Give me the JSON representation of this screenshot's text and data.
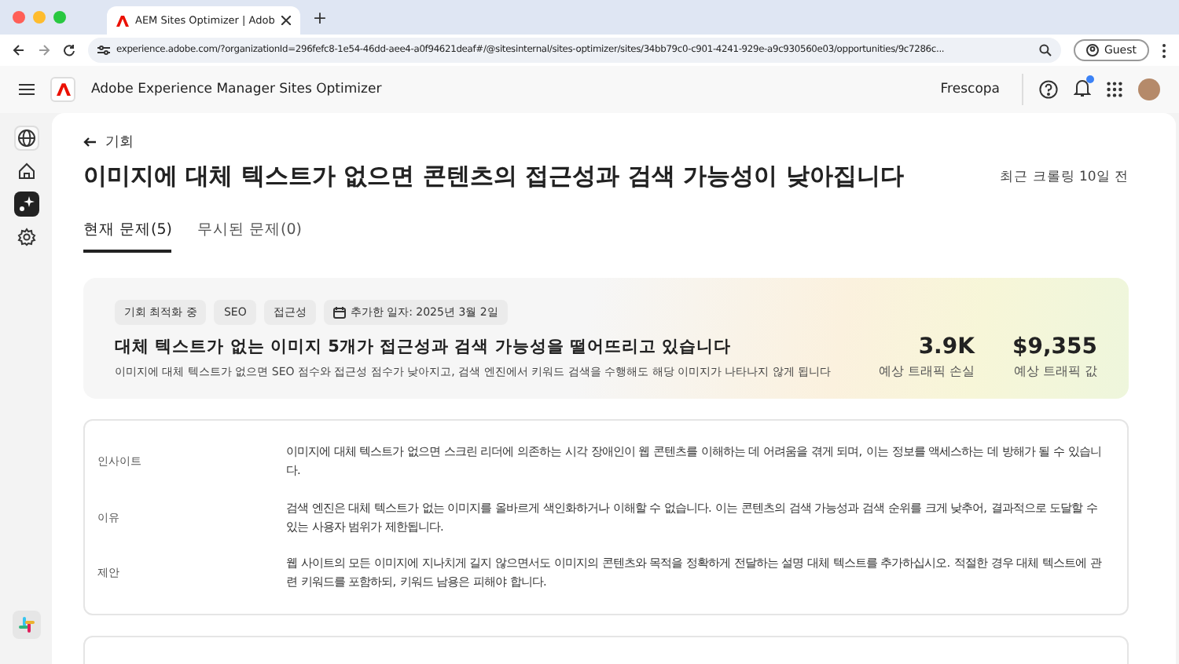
{
  "browser": {
    "tab_title": "AEM Sites Optimizer | Adob",
    "new_tab": "+",
    "url": "experience.adobe.com/?organizationId=296fefc8-1e54-46dd-aee4-a0f94621deaf#/@sitesinternal/sites-optimizer/sites/34bb79c0-c901-4241-929e-a9c930560e03/opportunities/9c7286c...",
    "profile": "Guest"
  },
  "app": {
    "title": "Adobe Experience Manager Sites Optimizer",
    "org": "Frescopa"
  },
  "sidebar": {
    "items": [
      {
        "kind": "globe",
        "selected": false
      },
      {
        "kind": "home",
        "selected": false
      },
      {
        "kind": "opportunities",
        "selected": true
      },
      {
        "kind": "settings",
        "selected": false
      }
    ]
  },
  "page": {
    "back_link": "기회",
    "title": "이미지에 대체 텍스트가 없으면 콘텐츠의 접근성과 검색 가능성이 낮아집니다",
    "crawl_info": "최근 크롤링 10일 전",
    "tabs": [
      {
        "label": "현재 문제(5)",
        "selected": true
      },
      {
        "label": "무시된 문제(0)",
        "selected": false
      }
    ]
  },
  "summary": {
    "tags": [
      "기회 최적화 중",
      "SEO",
      "접근성"
    ],
    "date_tag": "추가한 일자: 2025년 3월 2일",
    "heading": "대체 텍스트가 없는 이미지 5개가 접근성과 검색 가능성을 떨어뜨리고 있습니다",
    "description": "이미지에 대체 텍스트가 없으면 SEO 점수와 접근성 점수가 낮아지고, 검색 엔진에서 키워드 검색을 수행해도  해당 이미지가 나타나지 않게 됩니다",
    "metrics": [
      {
        "value": "3.9K",
        "label": "예상 트래픽 손실"
      },
      {
        "value": "$9,355",
        "label": "예상 트래픽 값"
      }
    ]
  },
  "details": {
    "rows": [
      {
        "label": "인사이트",
        "text": "이미지에 대체 텍스트가 없으면 스크린 리더에 의존하는 시각 장애인이 웹 콘텐츠를 이해하는 데 어려움을 겪게 되며, 이는 정보를 액세스하는 데 방해가 될 수 있습니다."
      },
      {
        "label": "이유",
        "text": "검색 엔진은 대체 텍스트가 없는 이미지를 올바르게 색인화하거나 이해할 수 없습니다. 이는 콘텐츠의 검색 가능성과 검색 순위를 크게 낮추어, 결과적으로 도달할 수 있는 사용자 범위가 제한됩니다."
      },
      {
        "label": "제안",
        "text": "웹 사이트의 모든 이미지에 지나치게 길지 않으면서도 이미지의 콘텐츠와 목적을 정확하게 전달하는 설명 대체 텍스트를 추가하십시오. 적절한 경우 대체 텍스트에 관련 키워드를 포함하되, 키워드 남용은 피해야 합니다."
      }
    ]
  }
}
